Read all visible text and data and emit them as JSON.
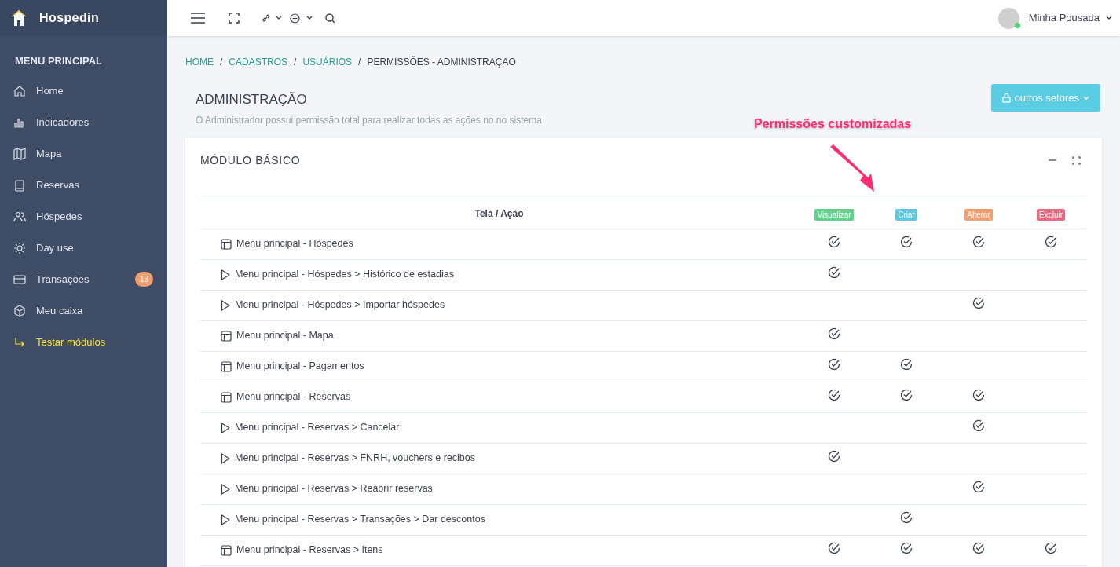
{
  "brand": {
    "name": "Hospedin"
  },
  "sidebar": {
    "heading": "MENU PRINCIPAL",
    "items": [
      {
        "label": "Home",
        "selected": false
      },
      {
        "label": "Indicadores",
        "selected": false
      },
      {
        "label": "Mapa",
        "selected": false
      },
      {
        "label": "Reservas",
        "selected": false
      },
      {
        "label": "Hóspedes",
        "selected": false
      },
      {
        "label": "Day use",
        "selected": false
      },
      {
        "label": "Transações",
        "selected": false,
        "badge": "13"
      },
      {
        "label": "Meu caixa",
        "selected": false
      },
      {
        "label": "Testar módulos",
        "selected": true
      }
    ]
  },
  "topbar": {
    "user": "Minha Pousada",
    "online": true
  },
  "breadcrumb": [
    {
      "kind": "link",
      "label": "HOME"
    },
    {
      "kind": "separator",
      "label": "/"
    },
    {
      "kind": "link",
      "label": "CADASTROS"
    },
    {
      "kind": "separator",
      "label": "/"
    },
    {
      "kind": "link",
      "label": "USUÁRIOS"
    },
    {
      "kind": "separator",
      "label": "/"
    },
    {
      "kind": "current",
      "label": "PERMISSÕES - ADMINISTRAÇÃO"
    }
  ],
  "header": {
    "title": "ADMINISTRAÇÃO",
    "subtitle": "O Administrador possui permissão total para realizar todas as ações no no sistema",
    "button": "outros setores"
  },
  "annotation": {
    "text": "Permissões customizadas"
  },
  "card": {
    "title": "MÓDULO BÁSICO",
    "table": {
      "first_column": "Tela / Ação",
      "columns": [
        {
          "label": "Visualizar",
          "color": "#5fd38d"
        },
        {
          "label": "Criar",
          "color": "#5bc9e1"
        },
        {
          "label": "Alterar",
          "color": "#f0a070"
        },
        {
          "label": "Excluir",
          "color": "#e8697f"
        }
      ],
      "rows": [
        {
          "kind": "screen",
          "label": "Menu principal - Hóspedes",
          "checks": [
            true,
            true,
            true,
            true
          ]
        },
        {
          "kind": "action",
          "label": "Menu principal - Hóspedes > Histórico de estadias",
          "checks": [
            true,
            false,
            false,
            false
          ]
        },
        {
          "kind": "action",
          "label": "Menu principal - Hóspedes > Importar hóspedes",
          "checks": [
            false,
            false,
            true,
            false
          ]
        },
        {
          "kind": "screen",
          "label": "Menu principal - Mapa",
          "checks": [
            true,
            false,
            false,
            false
          ]
        },
        {
          "kind": "screen",
          "label": "Menu principal - Pagamentos",
          "checks": [
            true,
            true,
            false,
            false
          ]
        },
        {
          "kind": "screen",
          "label": "Menu principal - Reservas",
          "checks": [
            true,
            true,
            true,
            false
          ]
        },
        {
          "kind": "action",
          "label": "Menu principal - Reservas > Cancelar",
          "checks": [
            false,
            false,
            true,
            false
          ]
        },
        {
          "kind": "action",
          "label": "Menu principal - Reservas > FNRH, vouchers e recibos",
          "checks": [
            true,
            false,
            false,
            false
          ]
        },
        {
          "kind": "action",
          "label": "Menu principal - Reservas > Reabrir reservas",
          "checks": [
            false,
            false,
            true,
            false
          ]
        },
        {
          "kind": "action",
          "label": "Menu principal - Reservas > Transações > Dar descontos",
          "checks": [
            false,
            true,
            false,
            false
          ]
        },
        {
          "kind": "screen",
          "label": "Menu principal - Reservas > Itens",
          "checks": [
            true,
            true,
            true,
            true
          ]
        }
      ]
    }
  }
}
